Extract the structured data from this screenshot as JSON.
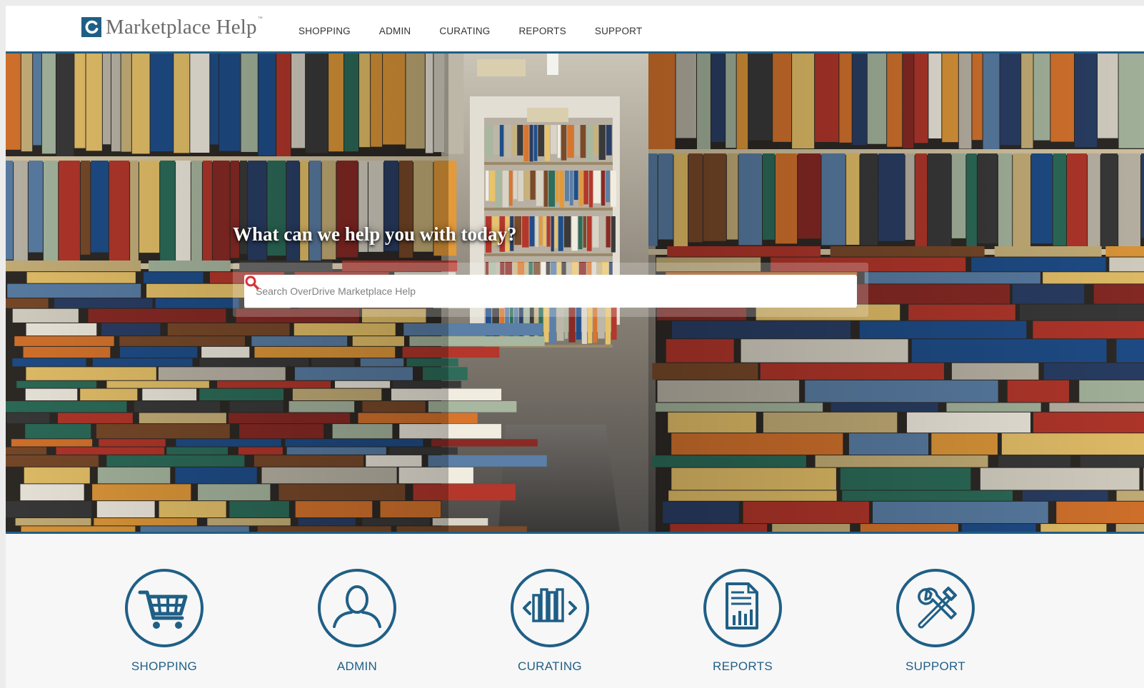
{
  "header": {
    "logo_text": "Marketplace Help",
    "logo_tm": "™",
    "nav": [
      "SHOPPING",
      "ADMIN",
      "CURATING",
      "REPORTS",
      "SUPPORT"
    ]
  },
  "hero": {
    "title": "What can we help you with today?",
    "search_placeholder": "Search OverDrive Marketplace Help",
    "search_value": ""
  },
  "categories": [
    {
      "label": "SHOPPING",
      "icon": "shopping-cart-icon"
    },
    {
      "label": "ADMIN",
      "icon": "user-icon"
    },
    {
      "label": "CURATING",
      "icon": "books-icon"
    },
    {
      "label": "REPORTS",
      "icon": "report-icon"
    },
    {
      "label": "SUPPORT",
      "icon": "tools-icon"
    }
  ],
  "colors": {
    "brand": "#1f5f86",
    "search_icon": "#d9323a",
    "background": "#f7f7f7"
  }
}
